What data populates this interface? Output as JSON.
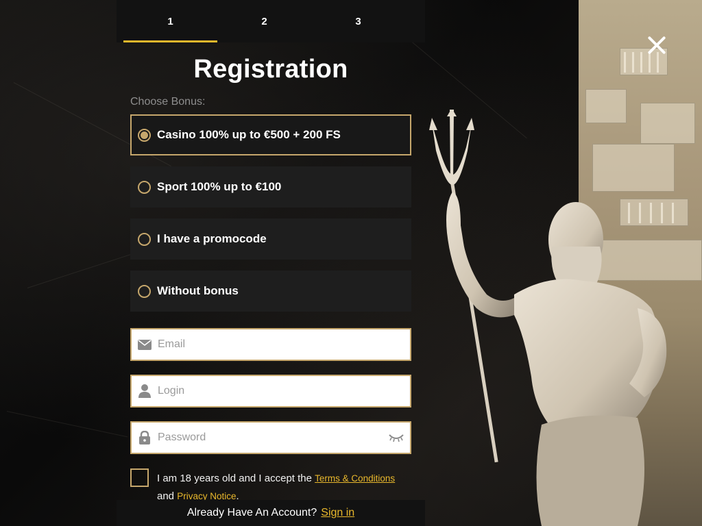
{
  "steps": [
    {
      "label": "1",
      "active": true
    },
    {
      "label": "2",
      "active": false
    },
    {
      "label": "3",
      "active": false
    }
  ],
  "title": "Registration",
  "bonus": {
    "label": "Choose Bonus:",
    "options": [
      {
        "label": "Casino 100% up to €500 + 200 FS",
        "selected": true
      },
      {
        "label": "Sport 100% up to €100",
        "selected": false
      },
      {
        "label": "I have a promocode",
        "selected": false
      },
      {
        "label": "Without bonus",
        "selected": false
      }
    ]
  },
  "form": {
    "email_placeholder": "Email",
    "email_value": "",
    "login_placeholder": "Login",
    "login_value": "",
    "password_placeholder": "Password",
    "password_value": ""
  },
  "terms": {
    "text_before": "I am 18 years old and I accept the ",
    "terms_link": "Terms & Conditions",
    "and_text": "and ",
    "privacy_link": "Privacy Notice",
    "period": ".",
    "checked": false
  },
  "footer": {
    "prompt": "Already Have An Account?",
    "signin_link": "Sign in"
  },
  "colors": {
    "accent": "#e9b82c",
    "gold_border": "#c6a76c",
    "panel": "#1e1e1e",
    "background": "#0b0b0b"
  },
  "icons": {
    "close": "close-icon",
    "email": "envelope-icon",
    "login": "user-icon",
    "password": "lock-icon",
    "visibility": "eye-closed-icon"
  }
}
